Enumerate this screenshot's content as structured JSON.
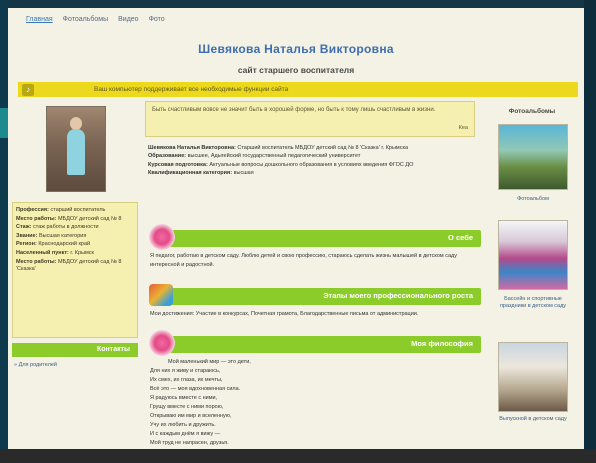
{
  "nav": {
    "items": [
      "Главная",
      "Фотоальбомы",
      "Видео",
      "Фото"
    ]
  },
  "header": {
    "title": "Шевякова Наталья Викторовна",
    "subtitle": "сайт старшего воспитателя"
  },
  "banner": {
    "text": "Ваш компьютер поддерживает все необходимые функции сайта"
  },
  "sidebar": {
    "info": [
      {
        "label": "Профессия:",
        "value": "старший воспитатель"
      },
      {
        "label": "Место работы:",
        "value": "МБДОУ детский сад № 8"
      },
      {
        "label": "Стаж:",
        "value": "стаж работы в должности"
      },
      {
        "label": "Звание:",
        "value": "Высшая категория"
      },
      {
        "label": "Регион:",
        "value": "Краснодарский край"
      },
      {
        "label": "Населенный пункт:",
        "value": "г. Крымск"
      },
      {
        "label": "Место работы:",
        "value": "МБДОУ детский сад № 8 'Сказка'"
      }
    ],
    "button_label": "Контакты",
    "link": "Для родителей"
  },
  "quote": {
    "text": "Быть счастливым вовсе не значит быть в хорошей форме, но быть к тому лишь счастливым в жизни.",
    "author": "Кеа"
  },
  "bio": {
    "lines": [
      {
        "label": "Шевякова Наталья Викторовна:",
        "value": "Старший воспитатель МБДОУ детский сад № 8 'Сказка' г. Крымска"
      },
      {
        "label": "Образование:",
        "value": "высшее, Адыгейский государственный педагогический университет"
      },
      {
        "label": "Курсовая подготовка:",
        "value": "Актуальные вопросы дошкольного образования в условиях введения ФГОС ДО"
      },
      {
        "label": "Квалификационная категория:",
        "value": "высшая"
      }
    ]
  },
  "sections": {
    "about": {
      "label": "О себе",
      "text": "Я педагог, работаю в детском саду. Люблю детей и свою профессию, стараюсь сделать жизнь малышей в детском саду интересной и радостной."
    },
    "growth": {
      "label": "Этапы моего профессионального роста",
      "text": "Мои достижения: Участие в конкурсах, Почетная грамота, Благодарственные письма от администрации."
    },
    "philosophy": {
      "label": "Моя философия"
    }
  },
  "poem": {
    "lines": [
      "Мой маленький мир — это дети,",
      "Для них я живу и стараюсь,",
      "Их смех, их глаза, их мечты,",
      "Всё это — моя вдохновенная сила.",
      "Я радуюсь вместе с ними,",
      "Грущу вместе с ними порою,",
      "Открываю им мир и вселенную,",
      "Учу их любить и дружить.",
      "И с каждым днём я вижу —",
      "Мой труд не напрасен, друзья."
    ]
  },
  "right": {
    "title": "Фотоальбомы",
    "captions": [
      "Фотоальбом",
      "Бассейн и спортивные праздники в детском саду",
      "Выпускной в детском саду"
    ]
  }
}
